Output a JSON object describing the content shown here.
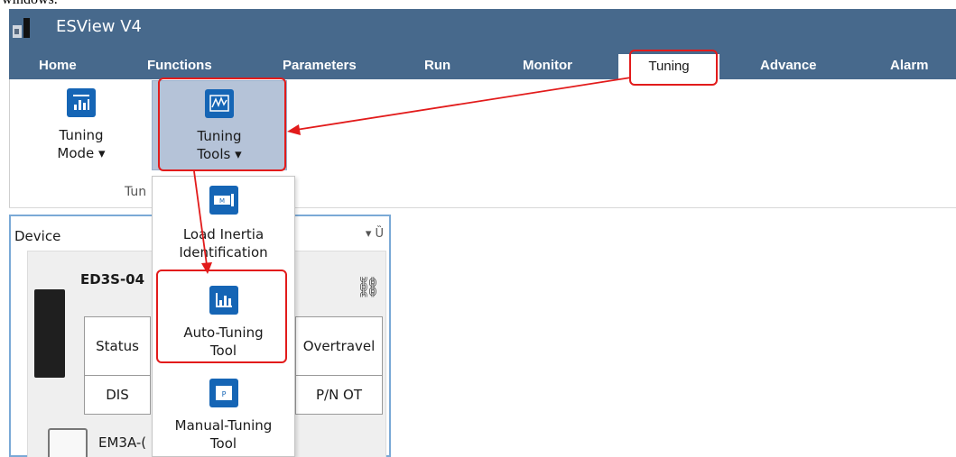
{
  "top_text": "windows.",
  "window": {
    "title": "ESView V4"
  },
  "menu": [
    "Home",
    "Functions",
    "Parameters",
    "Run",
    "Monitor",
    "Tuning",
    "Advance",
    "Alarm"
  ],
  "ribbon": {
    "tuning_mode": [
      "Tuning",
      "Mode ▾"
    ],
    "tuning_tools": [
      "Tuning",
      "Tools ▾"
    ],
    "group_label": "Tun"
  },
  "dropdown": {
    "load_inertia": [
      "Load Inertia",
      "Identification"
    ],
    "auto_tuning": [
      "Auto-Tuning",
      "Tool"
    ],
    "manual_tuning": [
      "Manual-Tuning",
      "Tool"
    ]
  },
  "device_panel": {
    "title": "Device",
    "pin": "▾ Ȕ",
    "model": "ED3S-04",
    "motor": "EM3A-(",
    "status_label": "Status",
    "status_value": "DIS",
    "overtravel_label": "Overtravel",
    "overtravel_value": "P/N OT"
  },
  "colors": {
    "titlebar": "#47698c",
    "accent": "#1565b5",
    "annotation": "#e21b1b",
    "selected": "#b5c3d8"
  }
}
